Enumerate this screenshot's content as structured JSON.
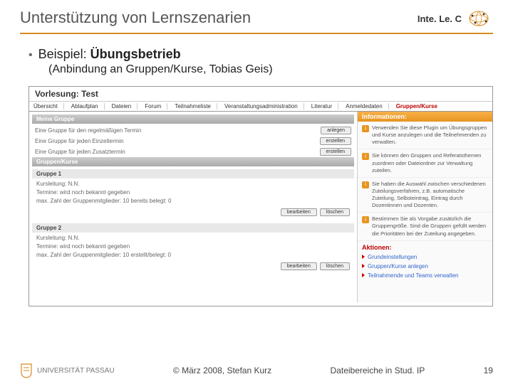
{
  "header": {
    "title": "Unterstützung von Lernszenarien",
    "logo": "Inte. Le. C"
  },
  "bullet": {
    "prefix": "Beispiel: ",
    "bold": "Übungsbetrieb",
    "sub": "(Anbindung an Gruppen/Kurse, Tobias Geis)"
  },
  "app": {
    "vorlesung_label": "Vorlesung: Test",
    "tabs": [
      "Übersicht",
      "Ablaufplan",
      "Dateien",
      "Forum",
      "Teilnahmeliste",
      "Veranstaltungsadministration",
      "Literatur",
      "Anmeldedaten",
      "Gruppen/Kurse"
    ],
    "section_meine": "Meine Gruppe",
    "create_rows": [
      {
        "label": "Eine Gruppe für den regelmäßigen Termin",
        "btn": "anlegen"
      },
      {
        "label": "Eine Gruppe für jeden Einzeltermin",
        "btn": "erstellen"
      },
      {
        "label": "Eine Gruppe für jeden Zusatztermin",
        "btn": "erstellen"
      }
    ],
    "section_gk": "Gruppen/Kurse",
    "groups": [
      {
        "title": "Gruppe 1",
        "leitung": "Kursleitung: N.N.",
        "termine": "Termine: wird noch bekannt gegeben",
        "max": "max. Zahl der Gruppenmitglieder: 10 bereits belegt: 0",
        "btns": [
          "bearbeiten",
          "löschen"
        ]
      },
      {
        "title": "Gruppe 2",
        "leitung": "Kursleitung: N.N.",
        "termine": "Termine: wird noch bekannt gegeben",
        "max": "max. Zahl der Gruppenmitglieder: 10 erstellt/belegt: 0",
        "btns": [
          "bearbeiten",
          "löschen"
        ]
      }
    ],
    "info": {
      "header": "Informationen:",
      "items": [
        "Verwenden Sie diese Plugin um Übungsgruppen und Kurse anzulegen und die Teilnehmenden zu verwalten.",
        "Sie können den Gruppen und Referatsthemen zuordnen oder Dateiordner zur Verwaltung zuteilen.",
        "Sie haben die Auswahl zwischen verschiedenen Zuteilungsverfahren, z.B. automatische Zuteilung, Selbsteintrag, Eintrag durch Dozentinnen und Dozenten.",
        "Bestimmen Sie als Vorgabe zusätzlich die Gruppengröße. Sind die Gruppen gefüllt werden die Prioritäten bei der Zuteilung angegeben."
      ],
      "aktionen": "Aktionen:",
      "links": [
        "Grundeinstellungen",
        "Gruppen/Kurse anlegen",
        "Teilnahmende und Teams verwalten"
      ]
    }
  },
  "footer": {
    "uni": "UNIVERSITÄT PASSAU",
    "copyright": "© März 2008, Stefan Kurz",
    "center": "Dateibereiche in Stud. IP",
    "page": "19"
  }
}
